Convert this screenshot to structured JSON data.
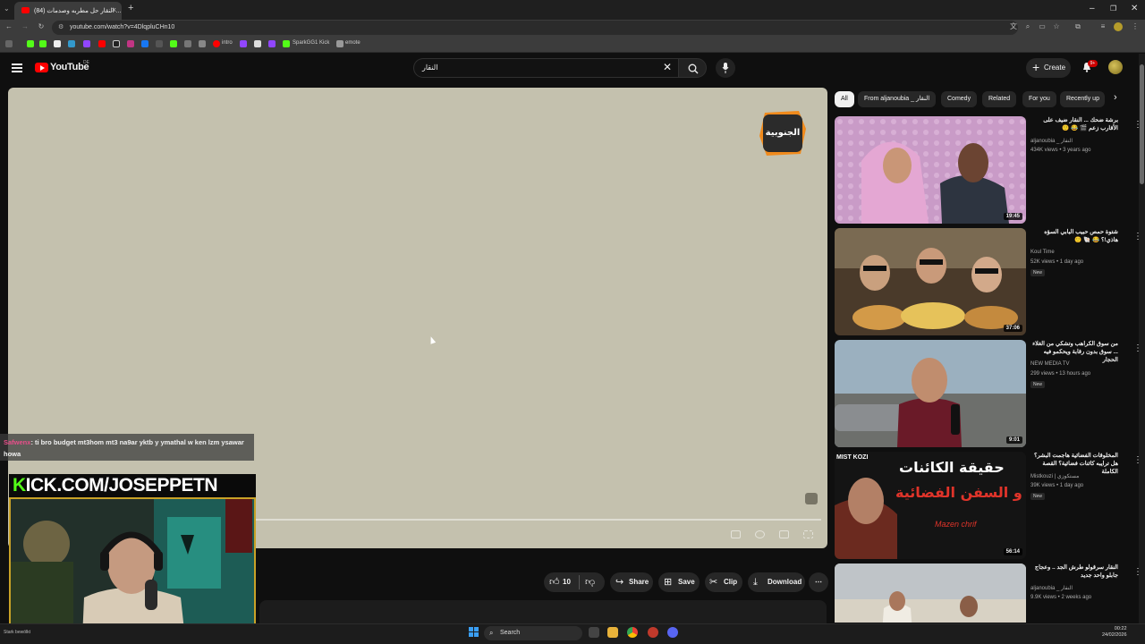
{
  "browser": {
    "tab_title": "(84) النقار حل مطربه وصدمات ... ",
    "url": "youtube.com/watch?v=4DlqpluCHn10",
    "bookmarks": [
      {
        "label": "intro"
      },
      {
        "label": "SparkGG1 Kick"
      },
      {
        "label": "emote"
      }
    ]
  },
  "youtube": {
    "logo_text": "YouTube",
    "country_code": "DE",
    "search_value": "النقار",
    "create_label": "Create",
    "notif_count": "9+"
  },
  "player": {
    "channel_logo_text": "الجنوبية"
  },
  "actions": {
    "like_count": "10",
    "share": "Share",
    "save": "Save",
    "clip": "Clip",
    "download": "Download"
  },
  "chips": [
    "All",
    "From aljanoubia _ النقار",
    "Comedy",
    "Related",
    "For you",
    "Recently up"
  ],
  "recommended": [
    {
      "title": "برشة ضحك ... النقار ضيف على الأقارب زعم 🎬 😂 🙂",
      "channel": "aljanoubia _ النقار",
      "meta": "434K views • 3 years ago",
      "duration": "19:45",
      "is_new": false
    },
    {
      "title": "شتوة حمص حبيب البابي السؤه هاذي!؟ 😂 🐚 🙂",
      "channel": "Koul Time",
      "meta": "52K views • 1 day ago",
      "duration": "37:06",
      "is_new": true
    },
    {
      "title": "من سوق الكراهب وتشكي من الغلاء ... سوق بدون رقابة ويحكمو فيه الحجار",
      "channel": "NEW MEDIA TV",
      "meta": "299 views • 13 hours ago",
      "duration": "9:01",
      "is_new": true
    },
    {
      "title": "المخلوقات الفضائية هاجمت البشر؟ هل ترايبه كائنات فضائية؟ القصة الكاملة",
      "channel": "Mistkouzi | مستكوزي",
      "meta": "39K views • 1 day ago",
      "duration": "56:14",
      "is_new": true
    },
    {
      "title": "النقار سرقولو طرش الجد .. وعجاج جابلو واحد جديد",
      "channel": "aljanoubia _ النقار",
      "meta": "9.9K views • 2 weeks ago",
      "duration": "",
      "is_new": false
    }
  ],
  "thumb4_text": {
    "top": "حقيقة الكائنات",
    "bottom": "و السفن الفضائية",
    "sign": "Mazen chrif",
    "brand": "MIST KOZI"
  },
  "stream": {
    "chat_user": "Safwenx",
    "chat_message": ": ti bro budget mt3hom mt3 na9ar yktb y ymathal w ken lzm ysawar howa",
    "kick_prefix": "K",
    "kick_url": "ICK.COM/JOSEPPETN"
  },
  "taskbar": {
    "search": "Search",
    "time": "00:22",
    "date": "24/02/2026",
    "weather": "Stark bewölkt"
  },
  "colors": {
    "accent": "#ff0000",
    "kick_green": "#53fc18",
    "player_bg": "#c4c1ae"
  }
}
